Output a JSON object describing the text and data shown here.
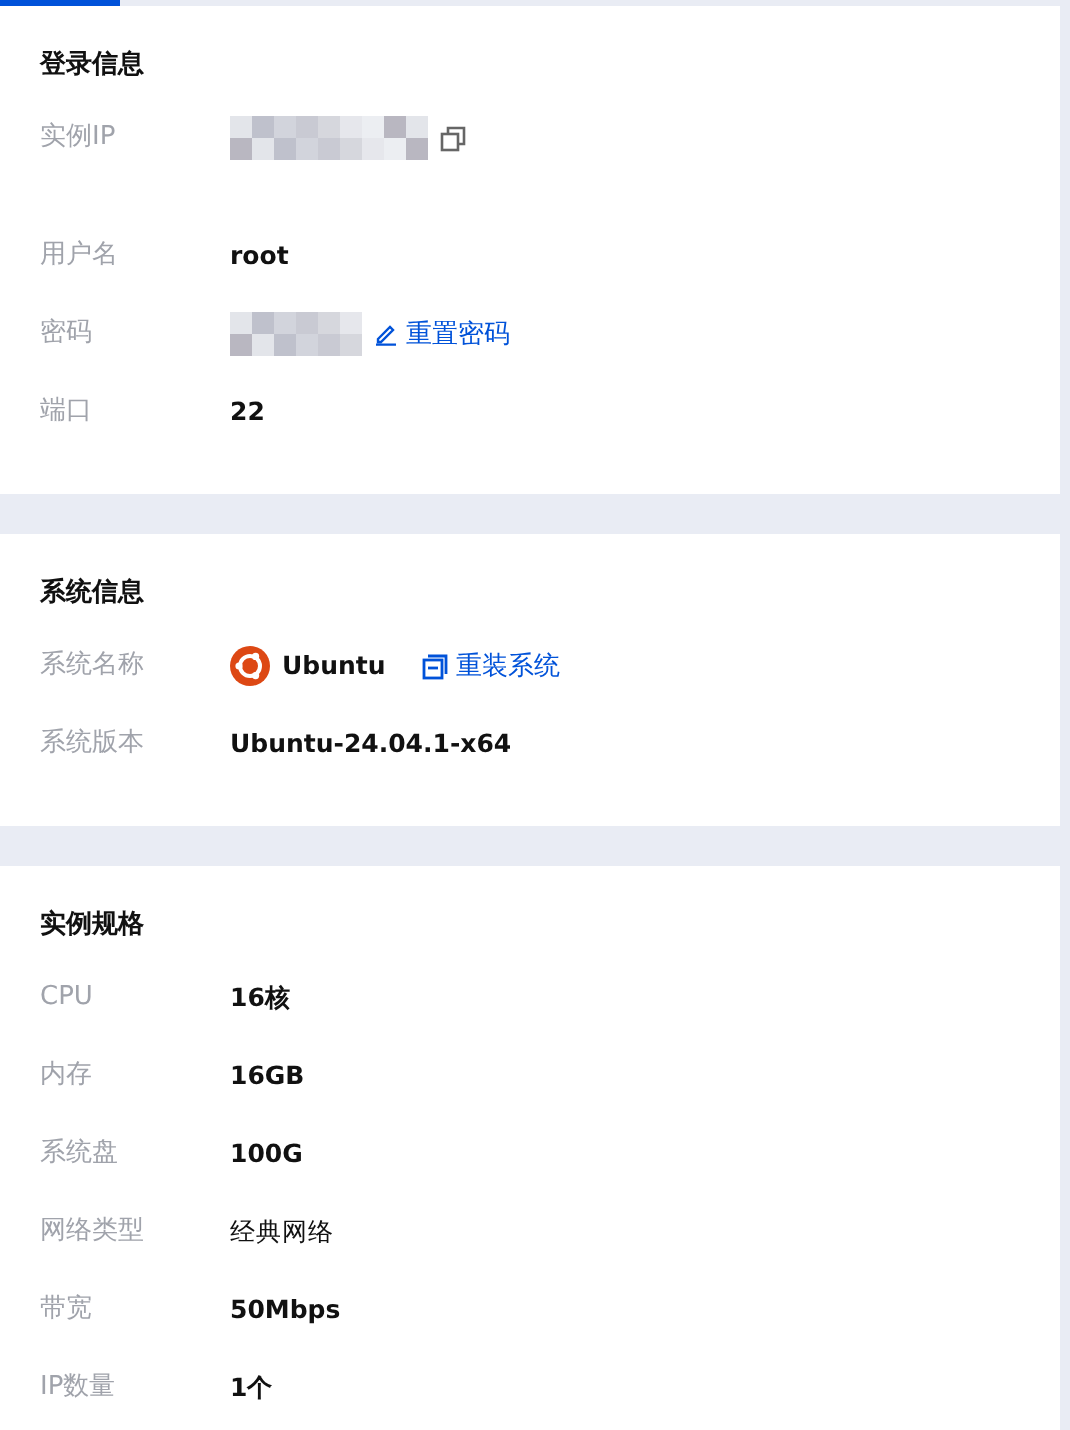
{
  "sections": [
    {
      "title": "登录信息",
      "rows": [
        {
          "kind": "masked",
          "label": "实例IP",
          "action": {
            "kind": "copy"
          }
        },
        {
          "kind": "text",
          "label": "用户名",
          "value": "root"
        },
        {
          "kind": "masked",
          "label": "密码",
          "action": {
            "kind": "edit",
            "label": "重置密码"
          }
        },
        {
          "kind": "text",
          "label": "端口",
          "value": "22"
        }
      ]
    },
    {
      "title": "系统信息",
      "rows": [
        {
          "kind": "os",
          "label": "系统名称",
          "value": "Ubuntu",
          "action": {
            "kind": "reinstall",
            "label": "重装系统"
          }
        },
        {
          "kind": "text",
          "label": "系统版本",
          "value": "Ubuntu-24.04.1-x64"
        }
      ]
    },
    {
      "title": "实例规格",
      "rows": [
        {
          "kind": "text",
          "label": "CPU",
          "value": "16核"
        },
        {
          "kind": "text",
          "label": "内存",
          "value": "16GB"
        },
        {
          "kind": "text",
          "label": "系统盘",
          "value": "100G"
        },
        {
          "kind": "plain",
          "label": "网络类型",
          "value": "经典网络"
        },
        {
          "kind": "text",
          "label": "带宽",
          "value": "50Mbps"
        },
        {
          "kind": "text",
          "label": "IP数量",
          "value": "1个"
        }
      ]
    }
  ]
}
